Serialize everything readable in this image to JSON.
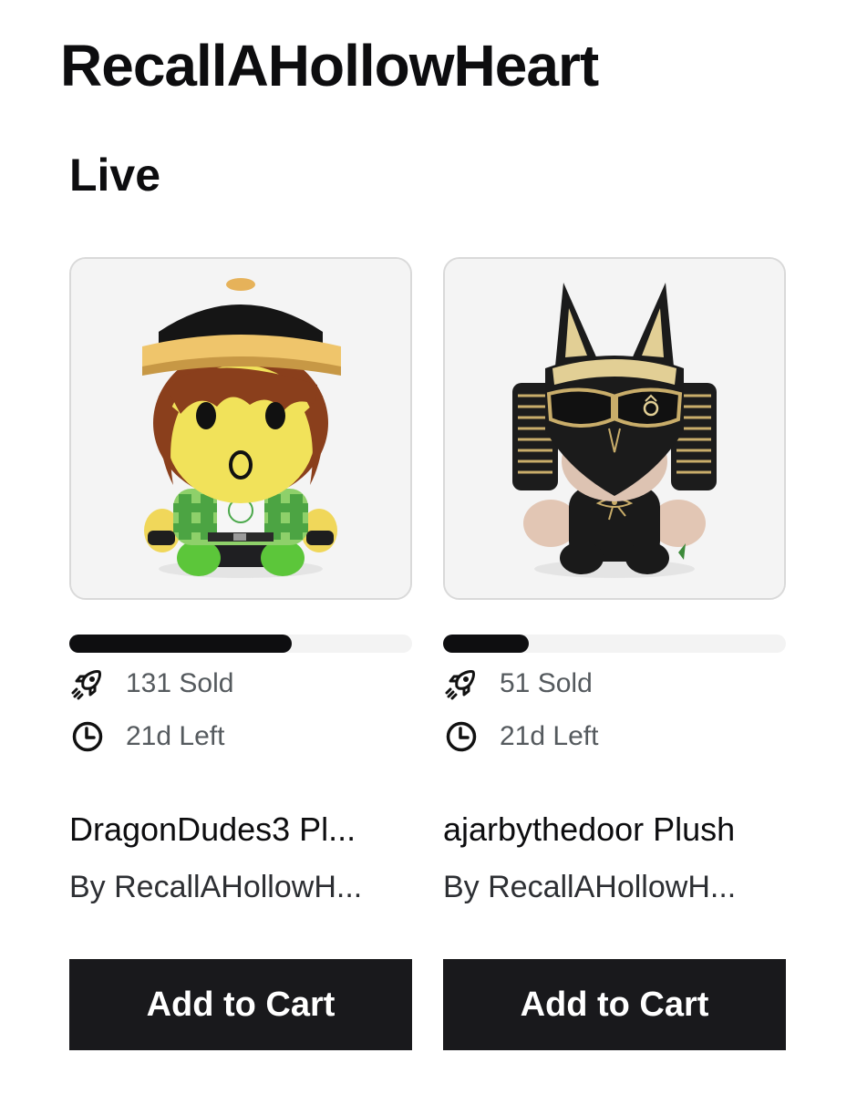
{
  "store": {
    "title": "RecallAHollowHeart"
  },
  "section": {
    "title": "Live"
  },
  "colors": {
    "button_bg": "#19191c",
    "progress_fill": "#0e0e10",
    "progress_track": "#f3f3f3",
    "muted_text": "#555a5e"
  },
  "products": [
    {
      "name": "DragonDudes3 Pl...",
      "by": "By RecallAHollowH...",
      "sold": "131 Sold",
      "time_left": "21d Left",
      "progress_fraction": 0.65,
      "cart_label": "Add to Cart",
      "image": "plush-boy-with-cap-and-green-flannel"
    },
    {
      "name": "ajarbythedoor Plush",
      "by": "By RecallAHollowH...",
      "sold": "51 Sold",
      "time_left": "21d Left",
      "progress_fraction": 0.25,
      "cart_label": "Add to Cart",
      "image": "plush-anubis-mask-black-gold"
    }
  ]
}
